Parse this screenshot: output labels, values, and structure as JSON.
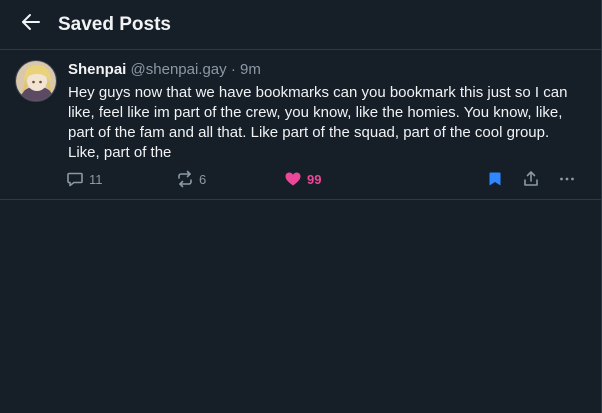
{
  "header": {
    "title": "Saved Posts"
  },
  "post": {
    "author_name": "Shenpai",
    "author_handle": "@shenpai.gay",
    "separator": "·",
    "time": "9m",
    "text": "Hey guys now that we have bookmarks can you bookmark this just so I can like, feel like im part of the crew, you know, like the homies. You know, like, part of the fam and all that. Like part of the squad, part of the cool group. Like, part of the",
    "reply_count": "11",
    "repost_count": "6",
    "like_count": "99"
  },
  "colors": {
    "background": "#161e27",
    "border": "#2f3944",
    "text": "#f1f3f5",
    "muted": "#8b98a5",
    "like": "#ec4899",
    "bookmark": "#2f88ff"
  },
  "icons": [
    "back-arrow-icon",
    "reply-icon",
    "repost-icon",
    "heart-icon",
    "bookmark-icon",
    "share-icon",
    "more-icon"
  ]
}
